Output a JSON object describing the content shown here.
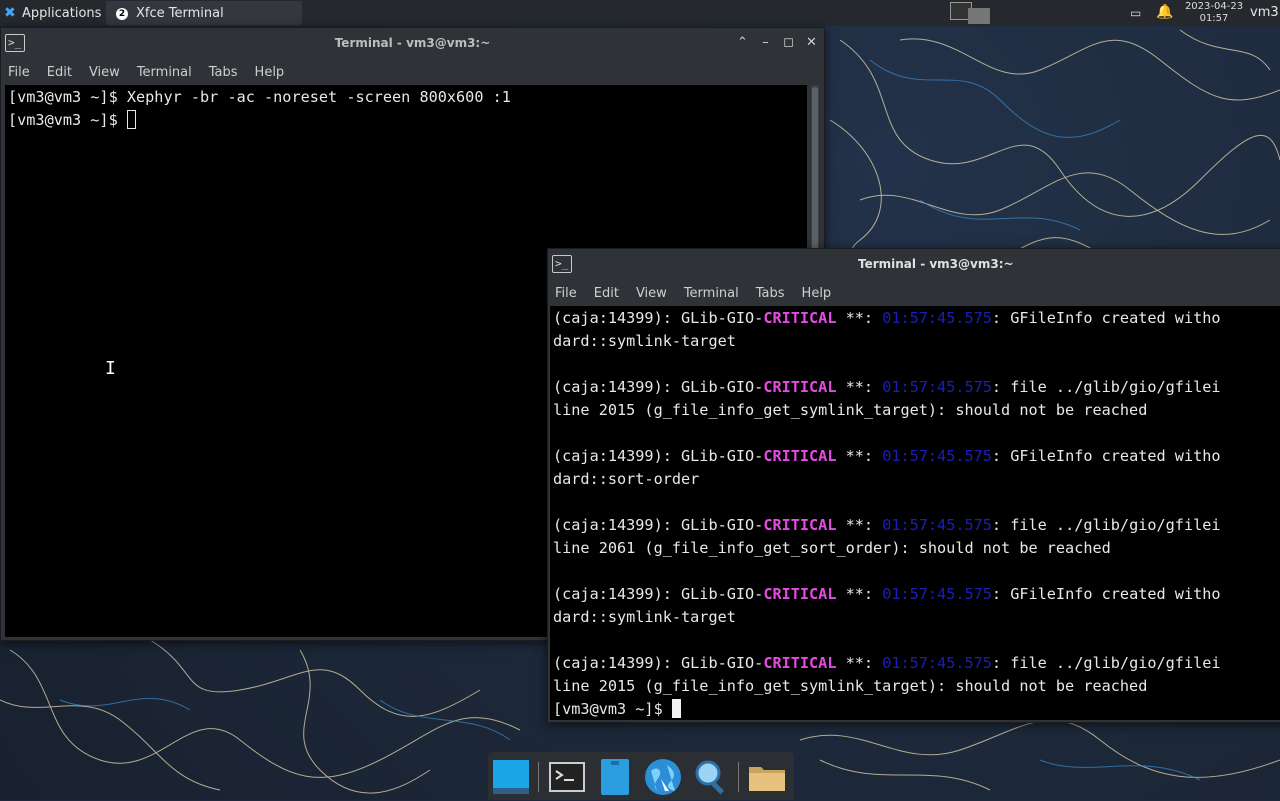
{
  "panel": {
    "apps_label": "Applications",
    "task_label": "Xfce Terminal",
    "task_badge": "2",
    "clock_date": "2023-04-23",
    "clock_time": "01:57",
    "user": "vm3"
  },
  "window1": {
    "title": "Terminal - vm3@vm3:~",
    "menu": [
      "File",
      "Edit",
      "View",
      "Terminal",
      "Tabs",
      "Help"
    ],
    "lines": [
      "[vm3@vm3 ~]$ Xephyr -br -ac -noreset -screen 800x600 :1",
      "[vm3@vm3 ~]$ "
    ]
  },
  "window2": {
    "title": "Terminal - vm3@vm3:~",
    "menu": [
      "File",
      "Edit",
      "View",
      "Terminal",
      "Tabs",
      "Help"
    ],
    "log": [
      {
        "prefix": "(caja:14399): GLib-GIO-",
        "level": "CRITICAL",
        "mid": " **: ",
        "ts": "01:57:45.575",
        "msg": ": GFileInfo created witho",
        "cont": "dard::symlink-target"
      },
      {
        "prefix": "(caja:14399): GLib-GIO-",
        "level": "CRITICAL",
        "mid": " **: ",
        "ts": "01:57:45.575",
        "msg": ": file ../glib/gio/gfilei",
        "cont": "line 2015 (g_file_info_get_symlink_target): should not be reached"
      },
      {
        "prefix": "(caja:14399): GLib-GIO-",
        "level": "CRITICAL",
        "mid": " **: ",
        "ts": "01:57:45.575",
        "msg": ": GFileInfo created witho",
        "cont": "dard::sort-order"
      },
      {
        "prefix": "(caja:14399): GLib-GIO-",
        "level": "CRITICAL",
        "mid": " **: ",
        "ts": "01:57:45.575",
        "msg": ": file ../glib/gio/gfilei",
        "cont": "line 2061 (g_file_info_get_sort_order): should not be reached"
      },
      {
        "prefix": "(caja:14399): GLib-GIO-",
        "level": "CRITICAL",
        "mid": " **: ",
        "ts": "01:57:45.575",
        "msg": ": GFileInfo created witho",
        "cont": "dard::symlink-target"
      },
      {
        "prefix": "(caja:14399): GLib-GIO-",
        "level": "CRITICAL",
        "mid": " **: ",
        "ts": "01:57:45.575",
        "msg": ": file ../glib/gio/gfilei",
        "cont": "line 2015 (g_file_info_get_symlink_target): should not be reached"
      }
    ],
    "prompt": "[vm3@vm3 ~]$ "
  },
  "dock": [
    "show-desktop-icon",
    "terminal-icon",
    "text-editor-icon",
    "web-browser-icon",
    "search-icon",
    "file-manager-icon"
  ]
}
